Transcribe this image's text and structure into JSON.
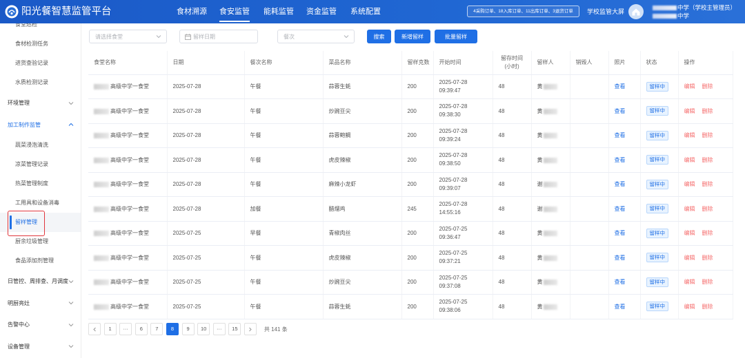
{
  "app": {
    "title": "阳光餐智慧监管平台"
  },
  "nav": {
    "items": [
      {
        "label": "食材溯源",
        "active": false
      },
      {
        "label": "食安监管",
        "active": true
      },
      {
        "label": "能耗监管",
        "active": false
      },
      {
        "label": "资金监管",
        "active": false
      },
      {
        "label": "系统配置",
        "active": false
      }
    ]
  },
  "header": {
    "order_summary": "4采购订单、18入库订单、11出库订单、3退货订单",
    "dashboard_link": "学校监管大屏",
    "user_role": "中学（学校主管理员）",
    "user_school": "中学"
  },
  "sidebar": {
    "items": [
      {
        "label": "食堂巡检",
        "type": "item"
      },
      {
        "label": "食材检测任务",
        "type": "item"
      },
      {
        "label": "进货查验记录",
        "type": "item"
      },
      {
        "label": "水质检测记录",
        "type": "item"
      },
      {
        "label": "环境管理",
        "type": "group",
        "expanded": false
      },
      {
        "label": "加工制作监管",
        "type": "group",
        "expanded": true
      },
      {
        "label": "蔬菜浸泡清洗",
        "type": "item"
      },
      {
        "label": "凉菜管理记录",
        "type": "item"
      },
      {
        "label": "热菜管理制度",
        "type": "item"
      },
      {
        "label": "工用具和设备消毒",
        "type": "item"
      },
      {
        "label": "留样管理",
        "type": "item",
        "active": true
      },
      {
        "label": "厨余垃圾管理",
        "type": "item"
      },
      {
        "label": "食品添加剂管理",
        "type": "item"
      },
      {
        "label": "日管控、周排查、月调度",
        "type": "group",
        "expanded": false
      },
      {
        "label": "明厨亮灶",
        "type": "group",
        "expanded": false
      },
      {
        "label": "告警中心",
        "type": "group",
        "expanded": false
      },
      {
        "label": "设备管理",
        "type": "group",
        "expanded": false
      }
    ]
  },
  "filters": {
    "canteen_placeholder": "请选择食堂",
    "date_placeholder": "留样日期",
    "meal_placeholder": "餐次",
    "search_button": "搜索",
    "add_button": "新增留样",
    "batch_button": "批量留样"
  },
  "table": {
    "columns": [
      "食堂名称",
      "日期",
      "餐次名称",
      "菜品名称",
      "留样克数",
      "开始时间",
      "留存时间\n(小时)",
      "留样人",
      "销毁人",
      "照片",
      "状态",
      "操作"
    ],
    "photo_label": "查看",
    "edit_label": "编辑",
    "delete_label": "删除",
    "rows": [
      {
        "canteen": "高级中学一食堂",
        "date": "2025-07-28",
        "meal": "午餐",
        "dish": "蒜蓉生蚝",
        "grams": "200",
        "start_date": "2025-07-28",
        "start_time": "09:39:47",
        "duration": "48",
        "sampler": "黄",
        "destroyer": "",
        "status": "留样中"
      },
      {
        "canteen": "高级中学一食堂",
        "date": "2025-07-28",
        "meal": "午餐",
        "dish": "炒豌豆尖",
        "grams": "200",
        "start_date": "2025-07-28",
        "start_time": "09:38:30",
        "duration": "48",
        "sampler": "黄",
        "destroyer": "",
        "status": "留样中"
      },
      {
        "canteen": "高级中学一食堂",
        "date": "2025-07-28",
        "meal": "午餐",
        "dish": "蒜蓉鲍鲷",
        "grams": "200",
        "start_date": "2025-07-28",
        "start_time": "09:39:24",
        "duration": "48",
        "sampler": "黄",
        "destroyer": "",
        "status": "留样中"
      },
      {
        "canteen": "高级中学一食堂",
        "date": "2025-07-28",
        "meal": "午餐",
        "dish": "虎皮辣椒",
        "grams": "200",
        "start_date": "2025-07-28",
        "start_time": "09:38:50",
        "duration": "48",
        "sampler": "黄",
        "destroyer": "",
        "status": "留样中"
      },
      {
        "canteen": "高级中学一食堂",
        "date": "2025-07-28",
        "meal": "午餐",
        "dish": "麻辣小龙虾",
        "grams": "200",
        "start_date": "2025-07-28",
        "start_time": "09:39:07",
        "duration": "48",
        "sampler": "谢",
        "destroyer": "",
        "status": "留样中"
      },
      {
        "canteen": "高级中学一食堂",
        "date": "2025-07-28",
        "meal": "加餐",
        "dish": "醋熘鸡",
        "grams": "245",
        "start_date": "2025-07-28",
        "start_time": "14:55:16",
        "duration": "48",
        "sampler": "谢",
        "destroyer": "",
        "status": "留样中"
      },
      {
        "canteen": "高级中学一食堂",
        "date": "2025-07-25",
        "meal": "早餐",
        "dish": "青椒肉丝",
        "grams": "200",
        "start_date": "2025-07-25",
        "start_time": "09:36:47",
        "duration": "48",
        "sampler": "黄",
        "destroyer": "",
        "status": "留样中"
      },
      {
        "canteen": "高级中学一食堂",
        "date": "2025-07-25",
        "meal": "午餐",
        "dish": "虎皮辣椒",
        "grams": "200",
        "start_date": "2025-07-25",
        "start_time": "09:37:21",
        "duration": "48",
        "sampler": "黄",
        "destroyer": "",
        "status": "留样中"
      },
      {
        "canteen": "高级中学一食堂",
        "date": "2025-07-25",
        "meal": "午餐",
        "dish": "炒豌豆尖",
        "grams": "200",
        "start_date": "2025-07-25",
        "start_time": "09:37:08",
        "duration": "48",
        "sampler": "黄",
        "destroyer": "",
        "status": "留样中"
      },
      {
        "canteen": "高级中学一食堂",
        "date": "2025-07-25",
        "meal": "午餐",
        "dish": "蒜蓉生蚝",
        "grams": "200",
        "start_date": "2025-07-25",
        "start_time": "09:38:06",
        "duration": "48",
        "sampler": "黄",
        "destroyer": "",
        "status": "留样中"
      }
    ]
  },
  "pagination": {
    "pages": [
      "1",
      "···",
      "6",
      "7",
      "8",
      "9",
      "10",
      "···",
      "15"
    ],
    "current": "8",
    "total_text": "共 141 条"
  },
  "colors": {
    "primary": "#1f6fe5",
    "header_bg": "#1d62cf",
    "danger": "#f56c6c",
    "annotation": "#e0353b"
  }
}
